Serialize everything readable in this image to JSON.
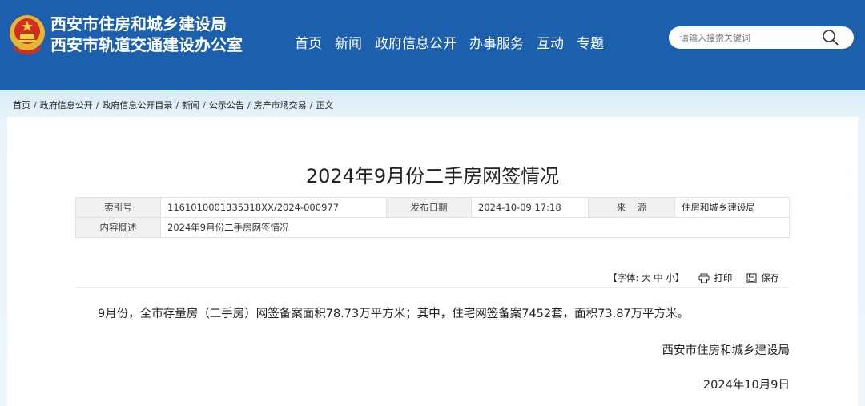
{
  "header": {
    "org_name_1": "西安市住房和城乡建设局",
    "org_name_2": "西安市轨道交通建设办公室",
    "nav": [
      "首页",
      "新闻",
      "政府信息公开",
      "办事服务",
      "互动",
      "专题"
    ],
    "search_placeholder": "请输入搜索关键词",
    "bg_color": "#1b5fad"
  },
  "breadcrumb": [
    "首页",
    "政府信息公开",
    "政府信息公开目录",
    "新闻",
    "公示公告",
    "房产市场交易",
    "正文"
  ],
  "article": {
    "title": "2024年9月份二手房网签情况",
    "meta": {
      "index_label": "索引号",
      "index_value": "1161010001335318XX/2024-000977",
      "date_label": "发布日期",
      "date_value": "2024-10-09 17:18",
      "source_label": "来    源",
      "source_value": "住房和城乡建设局",
      "summary_label": "内容概述",
      "summary_value": "2024年9月份二手房网签情况"
    },
    "tools": {
      "font_label": "【字体: 大 中 小】",
      "print_label": "打印",
      "save_label": "保存"
    },
    "body": "9月份，全市存量房（二手房）网签备案面积78.73万平方米；其中，住宅网签备案7452套，面积73.87万平方米。",
    "signature": "西安市住房和城乡建设局",
    "date": "2024年10月9日"
  }
}
